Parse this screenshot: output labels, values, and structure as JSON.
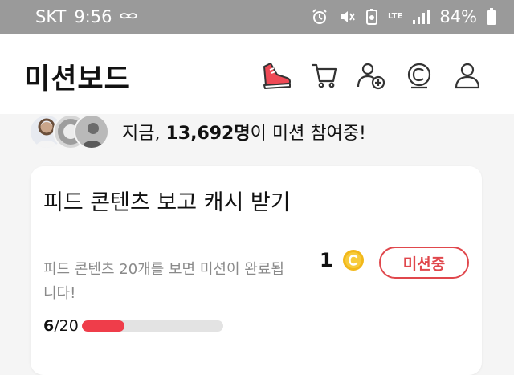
{
  "status_bar": {
    "carrier": "SKT",
    "time": "9:56",
    "network": "LTE",
    "battery": "84%",
    "icons": [
      "mustache-icon",
      "alarm-icon",
      "mute-icon",
      "data-saver-icon",
      "lte-icon",
      "signal-icon",
      "battery-icon"
    ]
  },
  "header": {
    "title": "미션보드",
    "icons": [
      "sneaker-icon",
      "cart-icon",
      "add-friend-icon",
      "cash-icon",
      "profile-icon"
    ]
  },
  "participants": {
    "prefix": "지금, ",
    "count": "13,692명",
    "suffix": "이 미션 참여중!"
  },
  "mission": {
    "title": "피드 콘텐츠 보고 캐시 받기",
    "description": "피드 콘텐츠 20개를 보면 미션이 완료됩니다!",
    "reward_amount": "1",
    "status_label": "미션중",
    "progress_current": "6",
    "progress_total": "/20",
    "progress_value": 0.3
  },
  "colors": {
    "accent": "#e0474c",
    "progress_fill": "#ef3d4a",
    "coin": "#f2b81a",
    "status_bar": "#9a9a9a"
  }
}
